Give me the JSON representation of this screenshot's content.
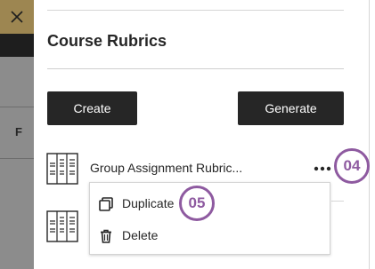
{
  "panel": {
    "title": "Course Rubrics",
    "create_label": "Create",
    "generate_label": "Generate"
  },
  "background": {
    "partial_letter": "F"
  },
  "rubrics": [
    {
      "name": "Group Assignment Rubric..."
    },
    {
      "name": ""
    }
  ],
  "menu": {
    "items": [
      {
        "label": "Duplicate",
        "icon": "duplicate-icon"
      },
      {
        "label": "Delete",
        "icon": "trash-icon"
      }
    ]
  },
  "callouts": {
    "step_a": "04",
    "step_b": "05",
    "color": "#8e5aa0"
  },
  "colors": {
    "button_bg": "#262626",
    "close_bg": "#9d8651"
  }
}
